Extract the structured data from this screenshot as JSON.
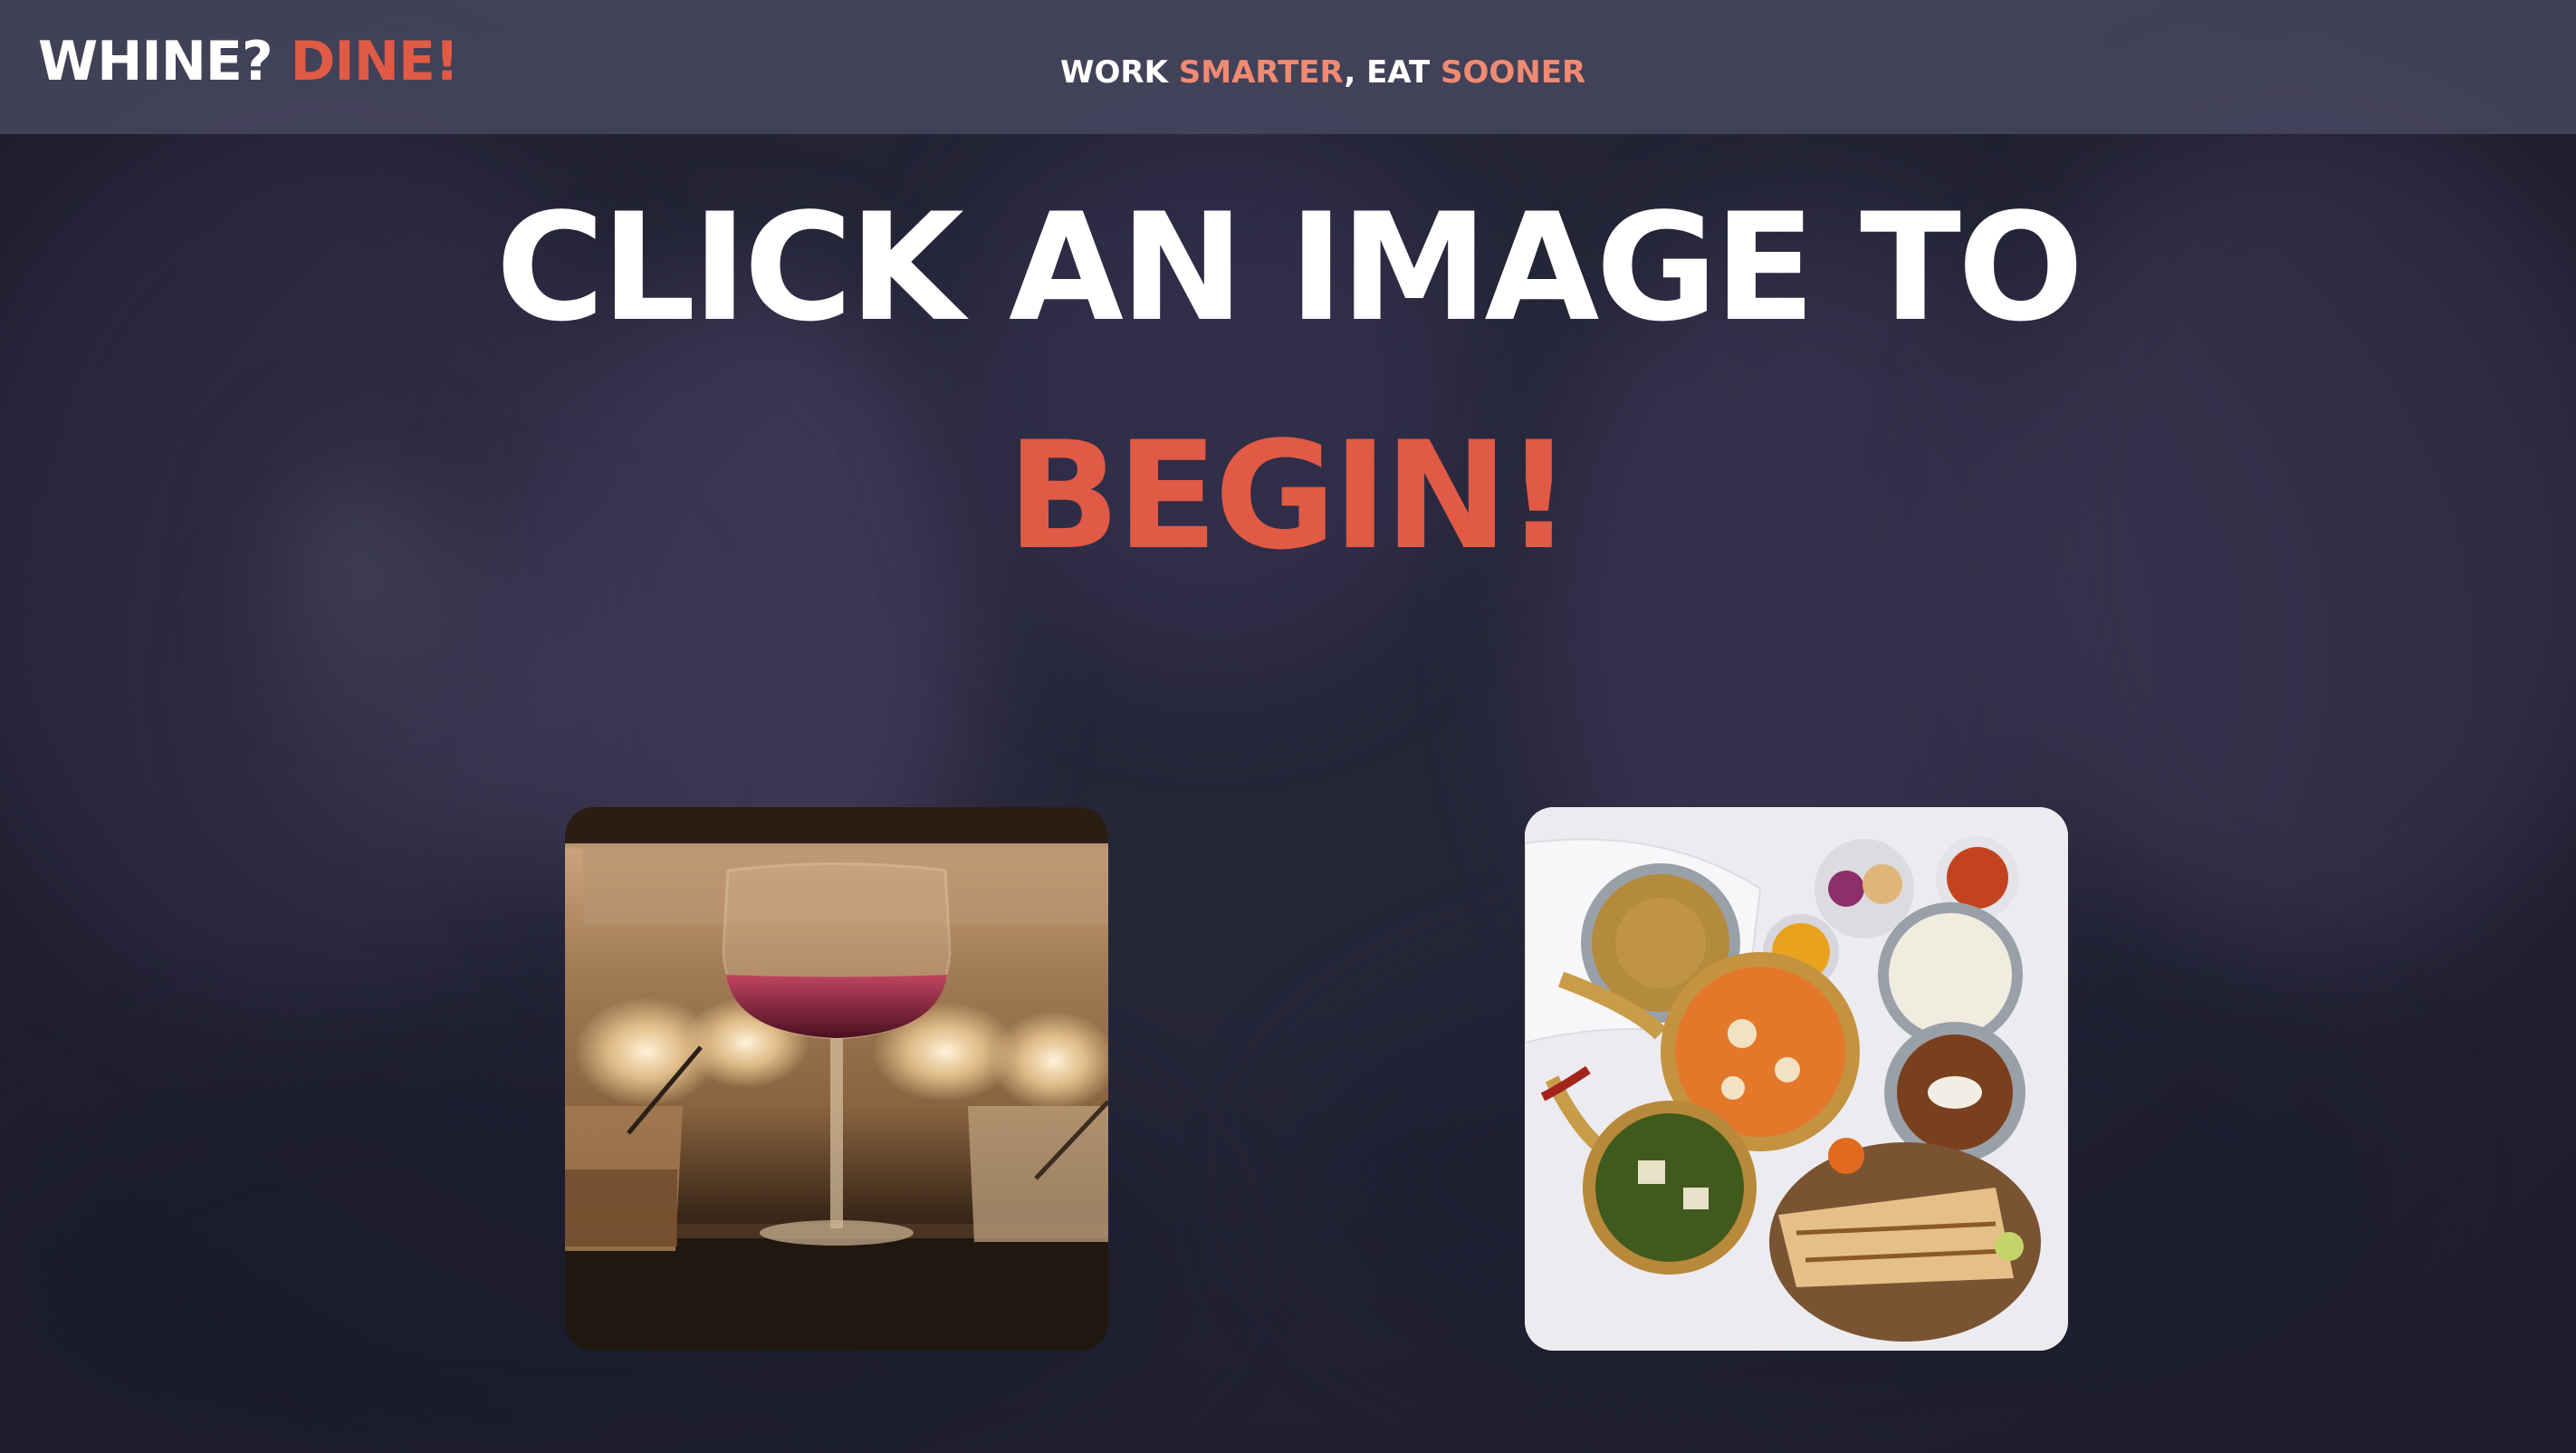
{
  "header": {
    "logo": {
      "part1": "WHINE?",
      "part2": "DINE!"
    },
    "tagline": {
      "w1": "WORK",
      "w2": "SMARTER",
      "w3": ", EAT",
      "w4": "SOONER"
    }
  },
  "main": {
    "heading_line1": "CLICK AN IMAGE TO",
    "heading_line2": "BEGIN!"
  },
  "options": [
    {
      "name": "wine-option",
      "icon": "wine-glass-image"
    },
    {
      "name": "dine-option",
      "icon": "indian-food-platter-image"
    }
  ],
  "colors": {
    "accent": "#e05a45",
    "accent_light": "#f08a72",
    "background": "#262639",
    "topbar": "#4e4e66",
    "text": "#ffffff"
  }
}
